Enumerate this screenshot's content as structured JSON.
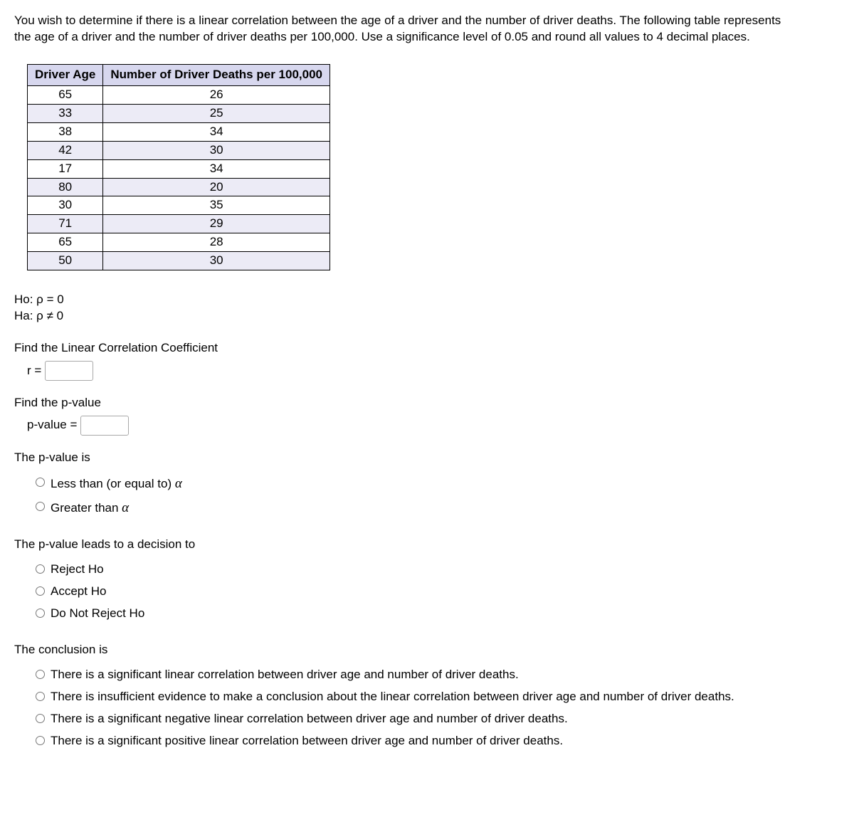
{
  "intro": "You wish to determine if there is a linear correlation between the age of a driver and the number of driver deaths. The following table represents the age of a driver and the number of driver deaths per 100,000. Use a significance level of 0.05 and round all values to 4 decimal places.",
  "table": {
    "headers": [
      "Driver Age",
      "Number of Driver Deaths per 100,000"
    ],
    "rows": [
      [
        "65",
        "26"
      ],
      [
        "33",
        "25"
      ],
      [
        "38",
        "34"
      ],
      [
        "42",
        "30"
      ],
      [
        "17",
        "34"
      ],
      [
        "80",
        "20"
      ],
      [
        "30",
        "35"
      ],
      [
        "71",
        "29"
      ],
      [
        "65",
        "28"
      ],
      [
        "50",
        "30"
      ]
    ]
  },
  "hypotheses": {
    "null": "Ho: ρ = 0",
    "alt": "Ha: ρ ≠ 0"
  },
  "q_r": {
    "prompt": "Find the Linear Correlation Coefficient",
    "label": "r ="
  },
  "q_p": {
    "prompt": "Find the p-value",
    "label": "p-value ="
  },
  "q_compare": {
    "prompt": "The p-value is",
    "options": [
      "Less than (or equal to) α",
      "Greater than α"
    ]
  },
  "q_decision": {
    "prompt": "The p-value leads to a decision to",
    "options": [
      "Reject Ho",
      "Accept Ho",
      "Do Not Reject Ho"
    ]
  },
  "q_conclusion": {
    "prompt": "The conclusion is",
    "options": [
      "There is a significant linear correlation between driver age and number of driver deaths.",
      "There is insufficient evidence to make a conclusion about the linear correlation between driver age and number of driver deaths.",
      "There is a significant negative linear correlation between driver age and number of driver deaths.",
      "There is a significant positive linear correlation between driver age and number of driver deaths."
    ]
  }
}
